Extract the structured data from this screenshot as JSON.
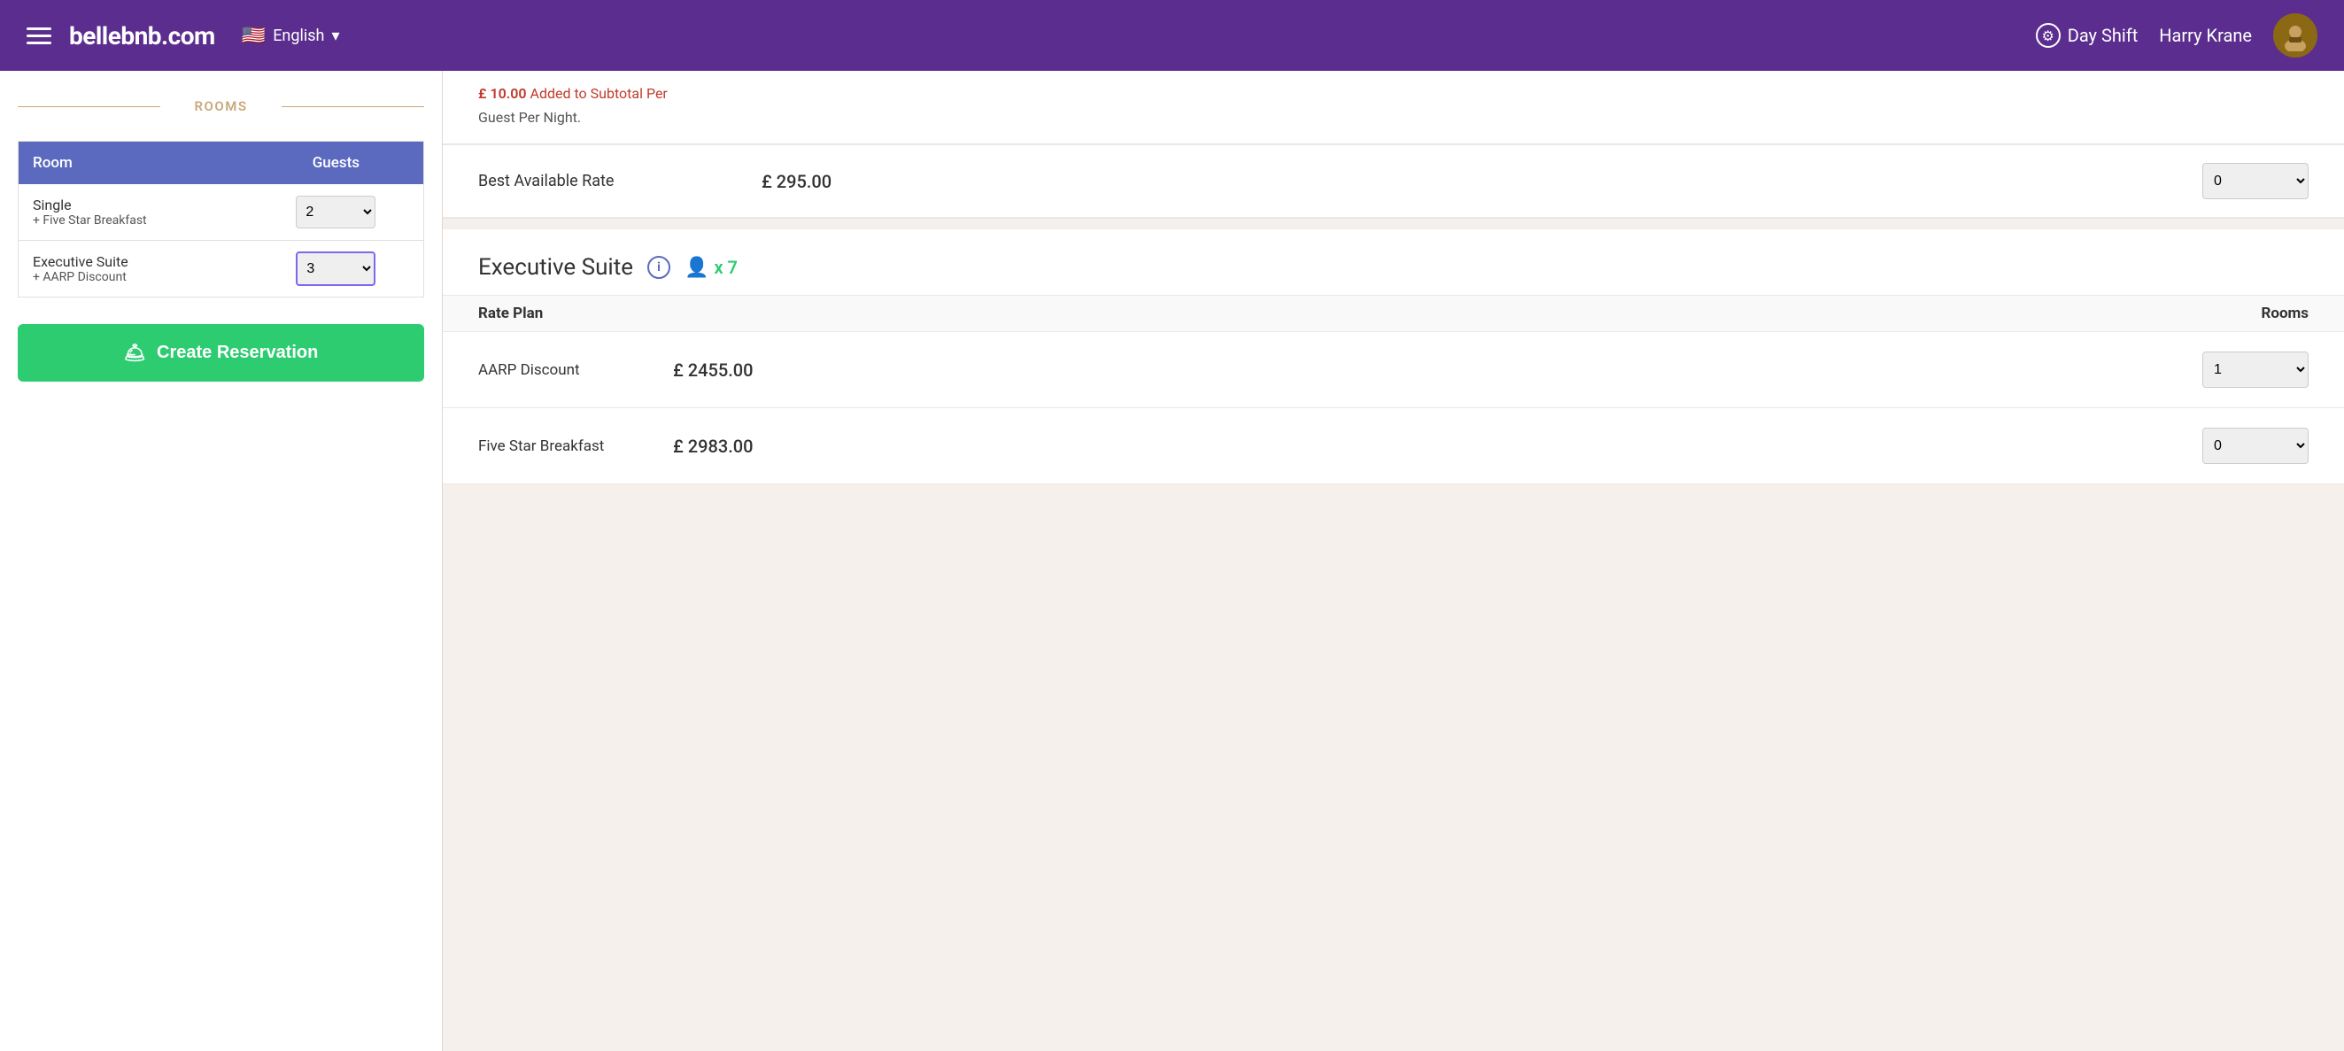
{
  "header": {
    "brand": "bellebnb.com",
    "language": "English",
    "shift": "Day Shift",
    "user": "Harry Krane"
  },
  "sidebar": {
    "rooms_label": "ROOMS",
    "table": {
      "col_room": "Room",
      "col_guests": "Guests",
      "rows": [
        {
          "room_name": "Single",
          "room_sub": "+ Five Star Breakfast",
          "guests_value": "2"
        },
        {
          "room_name": "Executive Suite",
          "room_sub": "+ AARP Discount",
          "guests_value": "3"
        }
      ]
    },
    "create_btn": "Create Reservation"
  },
  "content": {
    "partial": {
      "info_line1": "£ 10.00 Added to Subtotal Per",
      "info_line2": "Guest Per Night."
    },
    "best_available": {
      "label": "Best Available Rate",
      "price": "£ 295.00",
      "select_value": "0"
    },
    "executive_suite": {
      "title": "Executive Suite",
      "guest_count": "x 7",
      "rate_plan_col": "Rate Plan",
      "rooms_col": "Rooms",
      "rates": [
        {
          "name": "AARP Discount",
          "price": "£ 2455.00",
          "select_value": "1"
        },
        {
          "name": "Five Star Breakfast",
          "price": "£ 2983.00",
          "select_value": "0"
        }
      ]
    }
  }
}
